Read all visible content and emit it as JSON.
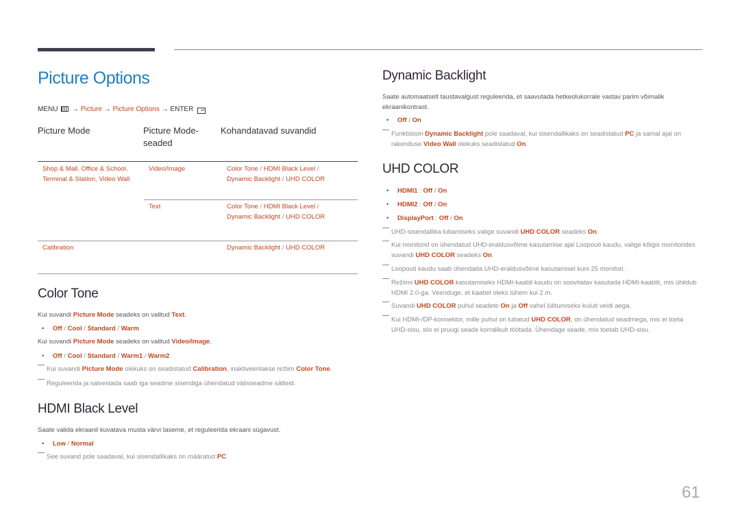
{
  "page_title": "Picture Options",
  "breadcrumb": {
    "menu": "MENU",
    "menu_icon": "menu-grid-icon",
    "arrow": "→",
    "picture": "Picture",
    "picture_options": "Picture Options",
    "enter": "ENTER",
    "enter_icon": "enter-icon"
  },
  "table": {
    "headers": [
      "Picture Mode",
      "Picture Mode-seaded",
      "Kohandatavad suvandid"
    ],
    "header_line1": "Picture Mode-",
    "header_line2": "seaded",
    "rows": [
      {
        "mode_a": "Shop & Mall",
        "mode_b": "Office & School",
        "mode_c": "Terminal & Station",
        "mode_d": "Video Wall",
        "setting": "Video/Image",
        "opt1": "Color Tone",
        "opt2": "HDMI Black Level",
        "opt3": "Dynamic Backlight",
        "opt4": "UHD COLOR"
      },
      {
        "setting": "Text",
        "opt1": "Color Tone",
        "opt2": "HDMI Black Level",
        "opt3": "Dynamic Backlight",
        "opt4": "UHD COLOR"
      },
      {
        "mode": "Calibration",
        "opt3": "Dynamic Backlight",
        "opt4": "UHD COLOR"
      }
    ]
  },
  "color_tone": {
    "title": "Color Tone",
    "p1_pre": "Kui suvandi ",
    "p1_hl1": "Picture Mode",
    "p1_mid": " seadeks on valitud ",
    "p1_hl2": "Text",
    "p1_end": ".",
    "bullet1": [
      "Off",
      "Cool",
      "Standard",
      "Warm"
    ],
    "p2_pre": "Kui suvandi ",
    "p2_hl1": "Picture Mode",
    "p2_mid": " seadeks on valitud ",
    "p2_hl2": "Video/Image",
    "p2_end": ".",
    "bullet2": [
      "Off",
      "Cool",
      "Standard",
      "Warm1",
      "Warm2"
    ],
    "note1_pre": "Kui suvandi ",
    "note1_hl1": "Picture Mode",
    "note1_mid": " olekuks on seadistatud ",
    "note1_hl2": "Calibration",
    "note1_mid2": ", inaktiveeritakse režiim ",
    "note1_hl3": "Color Tone",
    "note1_end": ".",
    "note2": "Reguleerida ja salvestada saab iga seadme sisendiga ühendatud välisseadme sätteid."
  },
  "hdmi_black": {
    "title": "HDMI Black Level",
    "desc": "Saate valida ekraanil kuvatava musta värvi taseme, et reguleerida ekraani sügavust.",
    "options": [
      "Low",
      "Normal"
    ],
    "note_pre": "See suvand pole saadaval, kui sisendallikaks on määratud ",
    "note_hl": "PC",
    "note_end": "."
  },
  "dynamic_backlight": {
    "title": "Dynamic Backlight",
    "desc": "Saate automaatselt taustavalgust reguleerida, et saavutada hetkeolukorrale vastav parim võimalik ekraanikontrast.",
    "options": [
      "Off",
      "On"
    ],
    "note_pre": "Funktsioon ",
    "note_hl1": "Dynamic Backlight",
    "note_mid": " pole saadaval, kui sisendallikaks on seadistatud ",
    "note_hl2": "PC",
    "note_mid2": " ja samal ajal on rakenduse ",
    "note_hl3": "Video Wall",
    "note_mid3": " olekuks seadistatud ",
    "note_hl4": "On",
    "note_end": "."
  },
  "uhd_color": {
    "title": "UHD COLOR",
    "inputs": [
      {
        "name": "HDMI1",
        "off": "Off",
        "on": "On"
      },
      {
        "name": "HDMI2",
        "off": "Off",
        "on": "On"
      },
      {
        "name": "DisplayPort",
        "off": "Off",
        "on": "On"
      }
    ],
    "n1_pre": "UHD-sisendallika lubamiseks valige suvandi ",
    "n1_hl1": "UHD COLOR",
    "n1_mid": " seadeks ",
    "n1_hl2": "On",
    "n1_end": ".",
    "n2_pre": "Kui monitorid on ühendatud UHD-eraldusvõime kasutamise ajal Loopouti kaudu, valige kõigis monitorides suvandi ",
    "n2_hl1": "UHD COLOR",
    "n2_mid": " seadeks ",
    "n2_hl2": "On",
    "n2_end": ".",
    "n3": "Loopouti kaudu saab ühendada UHD-eraldusvõime kasutamisel kuni 25 monitori.",
    "n4_pre": "Režiimi ",
    "n4_hl": "UHD COLOR",
    "n4_end": " kasutamiseks HDMI-kaabli kaudu on soovitatav kasutada HDMI-kaablit, mis ühildub HDMI 2.0-ga. Veenduge, et kaabel oleks lühem kui 2 m.",
    "n5_pre": "Suvandi ",
    "n5_hl1": "UHD COLOR",
    "n5_mid": " puhul seadete ",
    "n5_hl2": "On",
    "n5_mid2": " ja ",
    "n5_hl3": "Off",
    "n5_end": " vahel lülitumiseks kulub veidi aega.",
    "n6_pre": "Kui HDMI-/DP-konnektor, mille puhul on lubatud ",
    "n6_hl": "UHD COLOR",
    "n6_end": ", on ühendatud seadmega, mis ei toeta UHD-sisu, siis ei pruugi seade korralikult töötada. Ühendage seade, mis toetab UHD-sisu."
  },
  "separator": "/",
  "colon": ":",
  "page_number": "61",
  "colors": {
    "accent": "#c0461e",
    "title_blue": "#1f7fc4",
    "heading": "#2f2633"
  }
}
